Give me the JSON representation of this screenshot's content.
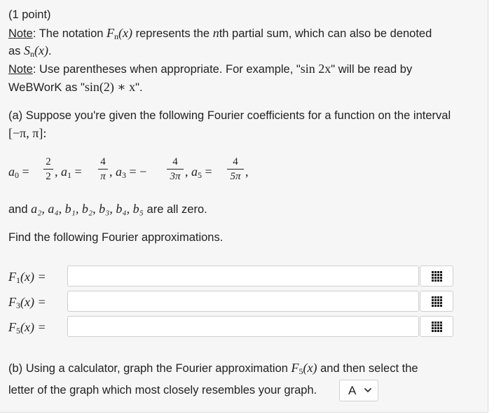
{
  "header": {
    "points": "(1 point)"
  },
  "note1": {
    "label": "Note",
    "text_a": ": The notation ",
    "symbol_Fn": "F",
    "sub_n": "n",
    "paren_x": "(x)",
    "text_b": " represents the ",
    "nth_n": "n",
    "text_c": "th partial sum, which can also be denoted",
    "text_d": "as ",
    "symbol_Sn": "S",
    "sub_n2": "n",
    "paren_x2": "(x)",
    "period": "."
  },
  "note2": {
    "label": "Note",
    "text_a": ": Use parentheses when appropriate. For example, \"",
    "example1": "sin 2x",
    "text_b": "\" will be read by",
    "text_c": "WeBWorK as \"",
    "example2": "sin(2) ∗ x",
    "text_d": "\"."
  },
  "part_a": {
    "intro": "(a) Suppose you're given the following Fourier coefficients for a function on the interval",
    "interval": "[−π, π]:",
    "coefficients": {
      "a0_label": "a",
      "a0_sub": "0",
      "a0_num": "2",
      "a0_den": "2",
      "a1_label": "a",
      "a1_sub": "1",
      "a1_num": "4",
      "a1_den": "π",
      "a3_label": "a",
      "a3_sub": "3",
      "a3_sign": "−",
      "a3_num": "4",
      "a3_den": "3π",
      "a5_label": "a",
      "a5_sub": "5",
      "a5_num": "4",
      "a5_den": "5π"
    },
    "zero_text_a": "and ",
    "zero_list": "a₂, a₄, b₁, b₂, b₃, b₄, b₅",
    "zero_text_b": " are all zero.",
    "instruction": "Find the following Fourier approximations.",
    "answers": [
      {
        "label": "F",
        "sub": "1",
        "rest": "(x) =",
        "value": ""
      },
      {
        "label": "F",
        "sub": "3",
        "rest": "(x) =",
        "value": ""
      },
      {
        "label": "F",
        "sub": "5",
        "rest": "(x) =",
        "value": ""
      }
    ]
  },
  "part_b": {
    "text_a": "(b) Using a calculator, graph the Fourier approximation ",
    "symbol": "F",
    "sub": "5",
    "paren_x": "(x)",
    "text_b": " and then select the",
    "text_c": "letter of the graph which most closely resembles your graph.",
    "select_value": "A"
  },
  "icons": {
    "equation_editor": "grid-icon",
    "dropdown": "chevron-down-icon"
  }
}
